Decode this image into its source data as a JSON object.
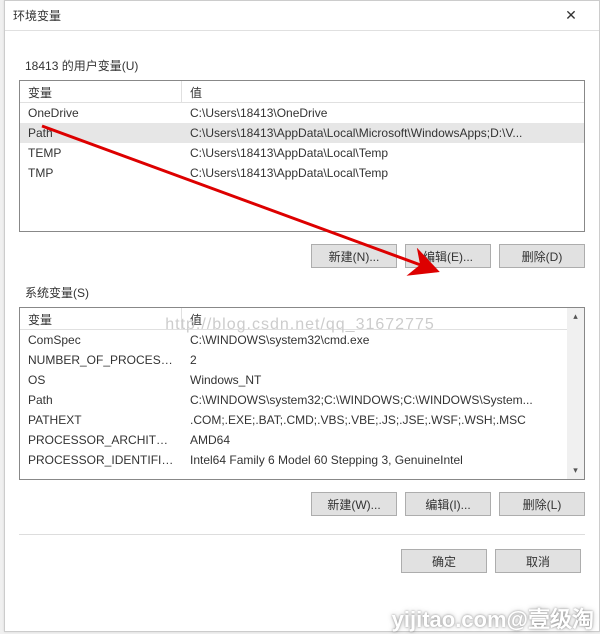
{
  "titlebar": {
    "title": "环境变量"
  },
  "sections": {
    "user": {
      "label": "18413 的用户变量(U)",
      "headers": {
        "name": "变量",
        "value": "值"
      },
      "rows": [
        {
          "name": "OneDrive",
          "value": "C:\\Users\\18413\\OneDrive"
        },
        {
          "name": "Path",
          "value": "C:\\Users\\18413\\AppData\\Local\\Microsoft\\WindowsApps;D:\\V...",
          "selected": true
        },
        {
          "name": "TEMP",
          "value": "C:\\Users\\18413\\AppData\\Local\\Temp"
        },
        {
          "name": "TMP",
          "value": "C:\\Users\\18413\\AppData\\Local\\Temp"
        }
      ],
      "buttons": {
        "new": "新建(N)...",
        "edit": "编辑(E)...",
        "del": "删除(D)"
      }
    },
    "system": {
      "label": "系统变量(S)",
      "headers": {
        "name": "变量",
        "value": "值"
      },
      "rows": [
        {
          "name": "ComSpec",
          "value": "C:\\WINDOWS\\system32\\cmd.exe"
        },
        {
          "name": "NUMBER_OF_PROCESSORS",
          "value": "2"
        },
        {
          "name": "OS",
          "value": "Windows_NT"
        },
        {
          "name": "Path",
          "value": "C:\\WINDOWS\\system32;C:\\WINDOWS;C:\\WINDOWS\\System..."
        },
        {
          "name": "PATHEXT",
          "value": ".COM;.EXE;.BAT;.CMD;.VBS;.VBE;.JS;.JSE;.WSF;.WSH;.MSC"
        },
        {
          "name": "PROCESSOR_ARCHITECT...",
          "value": "AMD64"
        },
        {
          "name": "PROCESSOR_IDENTIFIER",
          "value": "Intel64 Family 6 Model 60 Stepping 3, GenuineIntel"
        }
      ],
      "buttons": {
        "new": "新建(W)...",
        "edit": "编辑(I)...",
        "del": "删除(L)"
      }
    }
  },
  "footer": {
    "ok": "确定",
    "cancel": "取消"
  },
  "watermark": "http://blog.csdn.net/qq_31672775",
  "bottom_watermark": "yijitao.com@壹级淘"
}
